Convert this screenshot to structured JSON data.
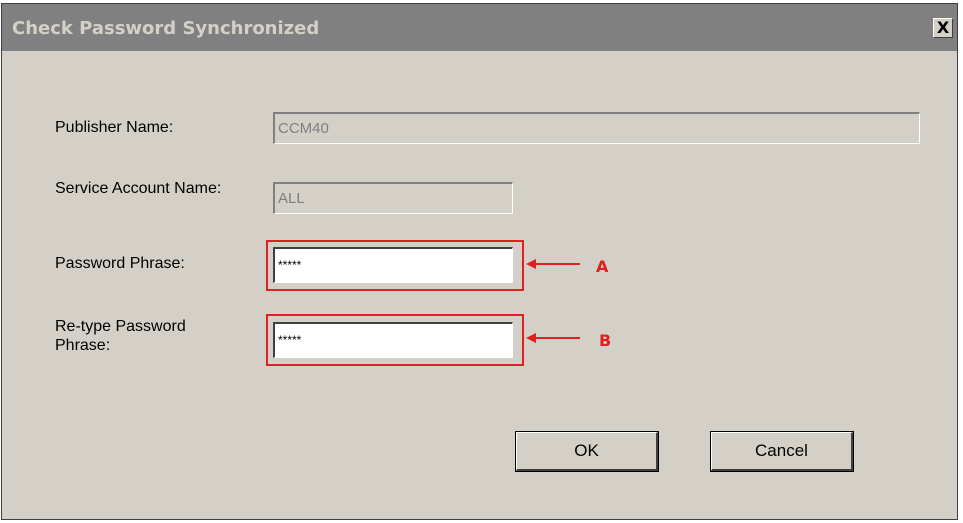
{
  "window": {
    "title": "Check Password Synchronized",
    "close_glyph": "X"
  },
  "form": {
    "publisher_name": {
      "label": "Publisher Name:",
      "value": "CCM40"
    },
    "service_account": {
      "label": "Service Account Name:",
      "value": "ALL"
    },
    "password_phrase": {
      "label": "Password Phrase:",
      "value": "*****"
    },
    "retype_password": {
      "label": "Re-type Password Phrase:",
      "value": "*****"
    }
  },
  "annotations": {
    "a": "A",
    "b": "B",
    "color": "#e02020"
  },
  "buttons": {
    "ok": "OK",
    "cancel": "Cancel"
  },
  "colors": {
    "dialog_bg": "#d4d0c8",
    "titlebar_bg": "#808080"
  }
}
